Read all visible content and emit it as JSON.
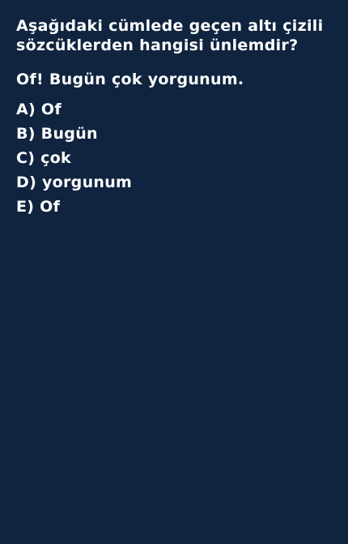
{
  "question": {
    "line1": "Aşağıdaki cümlede geçen altı çizili",
    "line2": "sözcüklerden hangisi ünlemdir?"
  },
  "sentence": "Of! Bugün çok yorgunum.",
  "options": [
    {
      "label": "A) Of"
    },
    {
      "label": "B) Bugün"
    },
    {
      "label": "C) çok"
    },
    {
      "label": "D) yorgunum"
    },
    {
      "label": "E) Of"
    }
  ],
  "colors": {
    "background": "#10243f",
    "text": "#ffffff"
  }
}
